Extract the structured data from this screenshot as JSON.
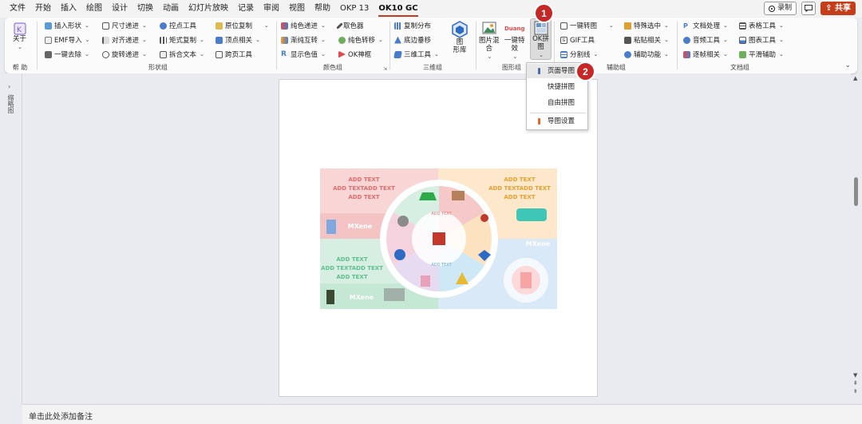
{
  "menubar": {
    "tabs": [
      "文件",
      "开始",
      "插入",
      "绘图",
      "设计",
      "切换",
      "动画",
      "幻灯片放映",
      "记录",
      "审阅",
      "视图",
      "帮助",
      "OKP 13",
      "OK10 GC"
    ],
    "record_label": "录制",
    "share_label": "共享"
  },
  "ribbon": {
    "help_group": {
      "button": "关于",
      "label": "帮 助"
    },
    "shape_group": {
      "label": "形状组",
      "col1": [
        "插入形状",
        "EMF导入",
        "一键去除"
      ],
      "col2": [
        "尺寸递进",
        "对齐递进",
        "旋转递进"
      ],
      "col3": [
        "控点工具",
        "矩式复制",
        "拆合文本"
      ],
      "col4": [
        "原位复制",
        "顶点相关",
        "跨页工具"
      ]
    },
    "color_group": {
      "label": "颜色组",
      "col1": [
        "纯色递进",
        "渐纯互转",
        "显示色值"
      ],
      "col2": [
        "取色器",
        "纯色转移",
        "OK神框"
      ]
    },
    "threed_group": {
      "label": "三维组",
      "items": [
        "复制分布",
        "底边垂移",
        "三维工具"
      ],
      "big": "图\n形库"
    },
    "image_group": {
      "label": "图形组",
      "big1": "图片混\n合",
      "big2": "一键特\n效",
      "big3": "OK拼\n图",
      "small_logo": "Duang"
    },
    "aux_group": {
      "label": "辅助组",
      "col1": [
        "一键转图",
        "GIF工具",
        "分割线"
      ],
      "col2": [
        "特殊选中",
        "粘贴相关",
        "辅助功能"
      ]
    },
    "doc_group": {
      "label": "文档组",
      "col1": [
        "文档处理",
        "音频工具",
        "逐帧相关"
      ],
      "col2": [
        "表格工具",
        "图表工具",
        "平滑辅助"
      ]
    }
  },
  "dropdown": {
    "items": [
      "页面导图",
      "快捷拼图",
      "自由拼图",
      "导图设置"
    ]
  },
  "callouts": [
    "1",
    "2"
  ],
  "graphic": {
    "add_text": "ADD TEXT",
    "add_text_double": "ADD TEXTADD TEXT",
    "mxene": "MXene"
  },
  "leftpane": {
    "label": "缩略图"
  },
  "notes": {
    "placeholder": "单击此处添加备注"
  },
  "colors": {
    "accent": "#c23b22",
    "callout": "#c62828",
    "share": "#c43e1c",
    "graphic_red": "#f5c9c9",
    "graphic_orange": "#fde4c1",
    "graphic_green": "#d0eddf",
    "graphic_blue": "#d4e6f5"
  }
}
